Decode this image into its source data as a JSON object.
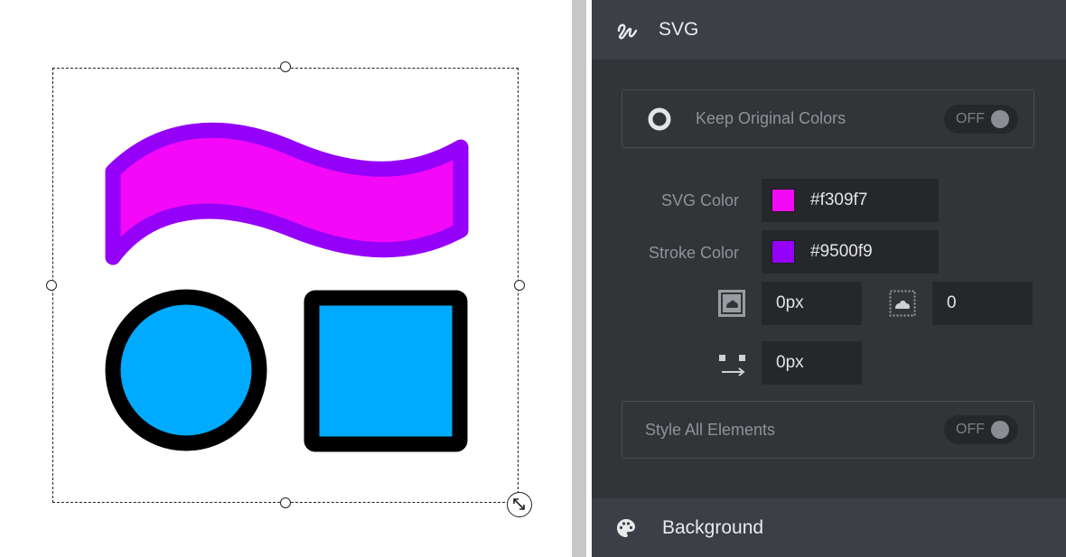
{
  "canvas": {
    "shapes": {
      "wave": {
        "fill": "#f309f7",
        "stroke": "#9500f9"
      },
      "circle": {
        "fill": "#00aaff",
        "stroke": "#000000"
      },
      "square": {
        "fill": "#00aaff",
        "stroke": "#000000"
      }
    }
  },
  "panel": {
    "svg_section": {
      "title": "SVG",
      "icon": "svg-path-icon"
    },
    "keep_original_colors": {
      "label": "Keep Original Colors",
      "toggle": "OFF",
      "icon": "ring-icon"
    },
    "svg_color": {
      "label": "SVG Color",
      "value": "#f309f7",
      "swatch": "#f309f7"
    },
    "stroke_color": {
      "label": "Stroke Color",
      "value": "#9500f9",
      "swatch": "#9500f9"
    },
    "stroke_width": {
      "value": "0px",
      "icon": "stroke-width-icon"
    },
    "shadow_blur": {
      "value": "0",
      "icon": "shadow-blur-icon"
    },
    "letter_spacing": {
      "value": "0px",
      "icon": "spacing-icon"
    },
    "style_all_elements": {
      "label": "Style All Elements",
      "toggle": "OFF"
    },
    "background_section": {
      "title": "Background",
      "icon": "palette-icon"
    }
  },
  "colors": {
    "panel_bg": "#323438",
    "header_bg": "#3c3f46",
    "field_bg": "#26272b"
  }
}
